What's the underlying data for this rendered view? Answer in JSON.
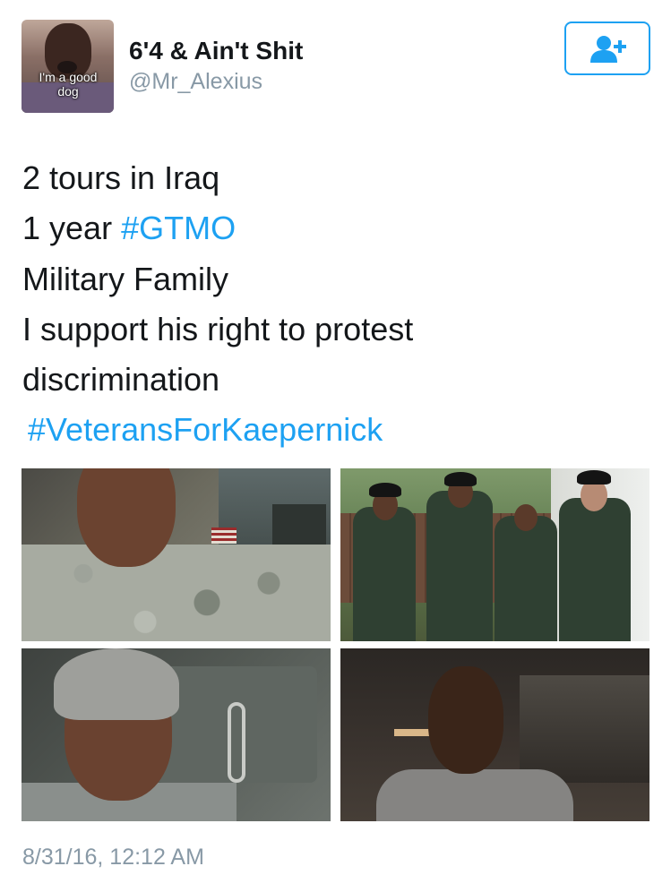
{
  "user": {
    "name": "6'4 & Ain't Shit",
    "handle": "@Mr_Alexius",
    "avatar_caption": "I'm a good dog"
  },
  "follow_button": {
    "icon": "follow-user-plus-icon",
    "color": "#1da1f2"
  },
  "tweet": {
    "lines": [
      {
        "text": "2 tours in Iraq"
      },
      {
        "prefix": "1 year ",
        "hashtag": "#GTMO"
      },
      {
        "text": "Military Family"
      },
      {
        "text": "I support his right to protest"
      },
      {
        "text": "discrimination"
      },
      {
        "prefix": "",
        "hashtag": "#VeteransForKaepernick"
      }
    ]
  },
  "photos": [
    {
      "name": "soldier-camo-selfie"
    },
    {
      "name": "family-dress-uniforms"
    },
    {
      "name": "soldier-beanie-vehicle"
    },
    {
      "name": "portrait-dark"
    }
  ],
  "timestamp": "8/31/16, 12:12 AM",
  "colors": {
    "link": "#1da1f2",
    "secondary_text": "#8899a6",
    "primary_text": "#14171a"
  }
}
